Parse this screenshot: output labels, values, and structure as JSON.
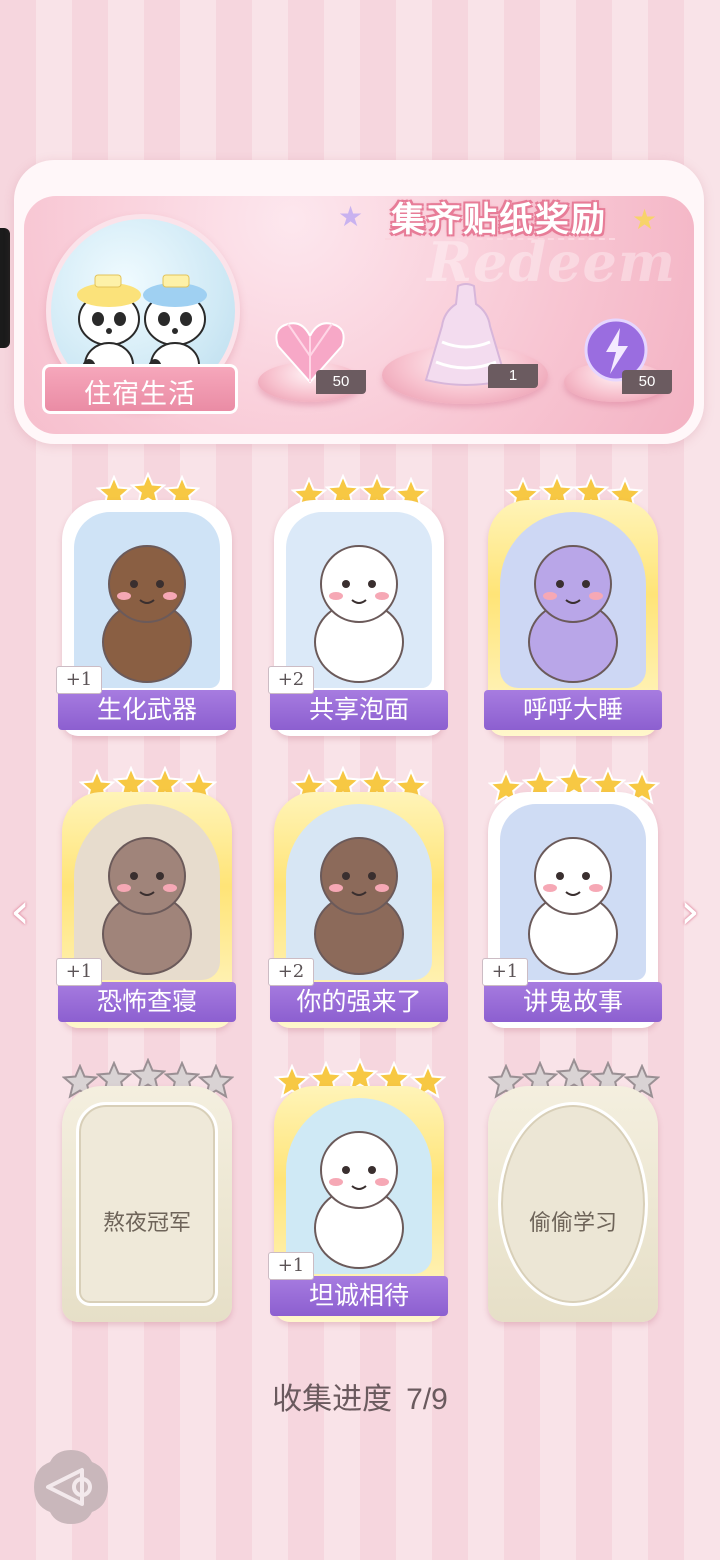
{
  "header": {
    "title": "集齐贴纸奖励",
    "watermark": "Redeem",
    "featured_label": "住宿生活",
    "rewards": [
      {
        "icon": "pink-heart-gem-icon",
        "count": "50"
      },
      {
        "icon": "dress-outfit-icon",
        "count": "1"
      },
      {
        "icon": "purple-energy-orb-icon",
        "count": "50"
      }
    ]
  },
  "cards": [
    {
      "label": "生化武器",
      "plus": "+1",
      "stars": 3,
      "state": "collected"
    },
    {
      "label": "共享泡面",
      "plus": "+2",
      "stars": 4,
      "state": "collected"
    },
    {
      "label": "呼呼大睡",
      "plus": "",
      "stars": 4,
      "state": "collected"
    },
    {
      "label": "恐怖查寝",
      "plus": "+1",
      "stars": 4,
      "state": "collected"
    },
    {
      "label": "你的强来了",
      "plus": "+2",
      "stars": 4,
      "state": "collected"
    },
    {
      "label": "讲鬼故事",
      "plus": "+1",
      "stars": 5,
      "state": "collected"
    },
    {
      "label": "熬夜冠军",
      "plus": "",
      "stars": 5,
      "state": "locked"
    },
    {
      "label": "坦诚相待",
      "plus": "+1",
      "stars": 5,
      "state": "collected"
    },
    {
      "label": "偷偷学习",
      "plus": "",
      "stars": 5,
      "state": "locked"
    }
  ],
  "progress": {
    "label": "收集进度",
    "value": "7/9"
  },
  "nav": {
    "left": "‹",
    "right": "›"
  },
  "colors": {
    "accent_purple": "#8c5fd0",
    "pink": "#f3b2c3",
    "gold": "#ffe477"
  }
}
